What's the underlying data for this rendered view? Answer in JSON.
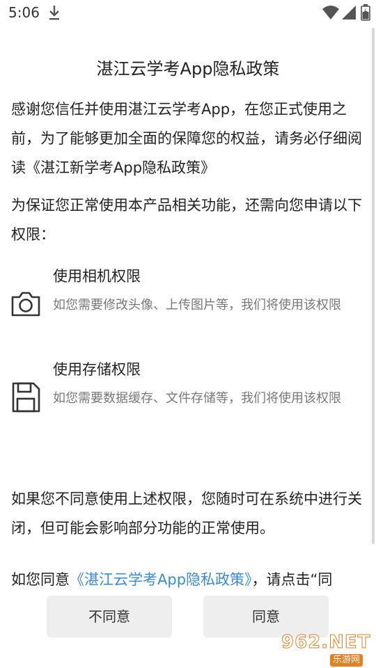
{
  "status_bar": {
    "time": "5:06"
  },
  "dialog": {
    "title": "湛江云学考App隐私政策",
    "intro": "感谢您信任并使用湛江云学考App，在您正式使用之前，为了能够更加全面的保障您的权益，请务必仔细阅读《湛江新学考App隐私政策》",
    "permission_intro": "为保证您正常使用本产品相关功能，还需向您申请以下权限：",
    "permissions": [
      {
        "title": "使用相机权限",
        "description": "如您需要修改头像、上传图片等，我们将使用该权限",
        "icon": "camera-icon"
      },
      {
        "title": "使用存储权限",
        "description": "如您需要数据缓存、文件存储等，我们将使用该权限",
        "icon": "save-disk-icon"
      }
    ],
    "closing": "如果您不同意使用上述权限，您随时可在系统中进行关闭，但可能会影响部分功能的正常使用。",
    "agree_prefix": "如您同意",
    "agree_link": "《湛江云学考App隐私政策》",
    "agree_suffix": "，请点击“同"
  },
  "buttons": {
    "disagree": "不同意",
    "agree": "同意"
  },
  "watermark": {
    "main": "962.NET",
    "sub": "乐游网"
  },
  "colors": {
    "link": "#3a8ad8",
    "button_bg": "#eeeeee",
    "watermark": "#e67e22"
  }
}
